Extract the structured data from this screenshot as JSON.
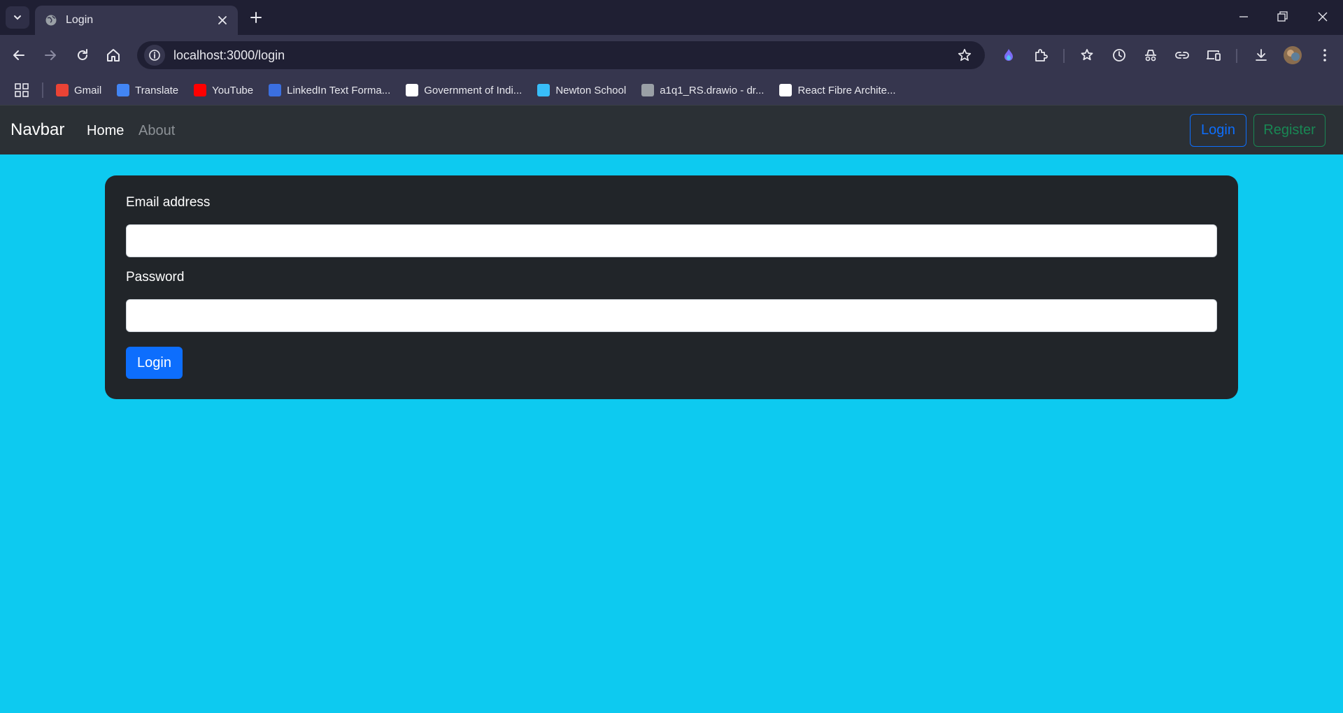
{
  "browser": {
    "tab_title": "Login",
    "url": "localhost:3000/login",
    "bookmarks": [
      {
        "label": "Gmail",
        "icon": "gmail-icon",
        "color": "#ea4335"
      },
      {
        "label": "Translate",
        "icon": "translate-icon",
        "color": "#4285f4"
      },
      {
        "label": "YouTube",
        "icon": "youtube-icon",
        "color": "#ff0000"
      },
      {
        "label": "LinkedIn Text Forma...",
        "icon": "linkedin-text-icon",
        "color": "#3b6fe0"
      },
      {
        "label": "Government of Indi...",
        "icon": "government-emblem-icon",
        "color": "#ffffff"
      },
      {
        "label": "Newton School",
        "icon": "newton-school-icon",
        "color": "#38bdf8"
      },
      {
        "label": "a1q1_RS.drawio - dr...",
        "icon": "drawio-icon",
        "color": "#9aa0a6"
      },
      {
        "label": "React  Fibre Archite...",
        "icon": "github-icon",
        "color": "#ffffff"
      }
    ]
  },
  "navbar": {
    "brand": "Navbar",
    "links": [
      "Home",
      "About"
    ],
    "login_label": "Login",
    "register_label": "Register"
  },
  "form": {
    "email_label": "Email address",
    "email_value": "",
    "password_label": "Password",
    "password_value": "",
    "submit_label": "Login"
  },
  "colors": {
    "page_bg": "#0dcaf0",
    "navbar_bg": "#2b3035",
    "card_bg": "#212529",
    "primary": "#0d6efd",
    "success": "#198754"
  }
}
